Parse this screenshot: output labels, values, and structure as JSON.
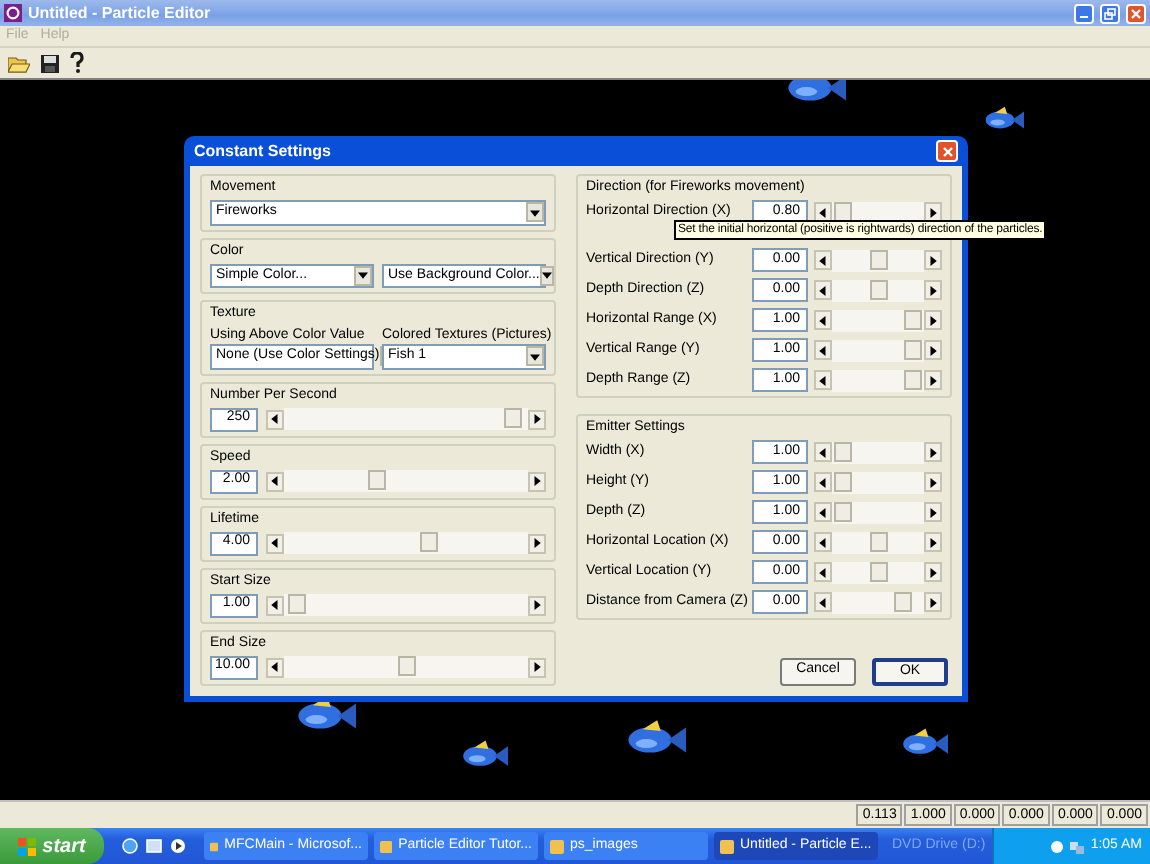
{
  "window": {
    "title": "Untitled - Particle Editor"
  },
  "menu": [
    {
      "label": "File",
      "disabled": true
    },
    {
      "label": "Help",
      "disabled": true
    }
  ],
  "dialog": {
    "title": "Constant Settings",
    "left_groups": [
      {
        "title": "Movement",
        "kind": "dropdowns",
        "dropdowns": [
          {
            "value": "Fireworks"
          }
        ]
      },
      {
        "title": "Color",
        "kind": "dropdowns",
        "dropdowns": [
          {
            "value": "Simple Color..."
          },
          {
            "value": "Use Background Color..."
          }
        ]
      },
      {
        "title": "Texture",
        "kind": "dropdowns",
        "dropdowns": [
          {
            "label": "Using Above Color Value",
            "value": "None (Use Color Settings)"
          },
          {
            "label": "Colored Textures (Pictures)",
            "value": "Fish 1"
          }
        ]
      },
      {
        "title": "Number Per Second",
        "kind": "slider",
        "value": "250",
        "level": 0.97
      },
      {
        "title": "Speed",
        "kind": "slider",
        "value": "2.00",
        "level": 0.37
      },
      {
        "title": "Lifetime",
        "kind": "slider",
        "value": "4.00",
        "level": 0.6
      },
      {
        "title": "Start Size",
        "kind": "slider",
        "value": "1.00",
        "level": 0.02
      },
      {
        "title": "End Size",
        "kind": "slider",
        "value": "10.00",
        "level": 0.5
      }
    ],
    "right_groups": [
      {
        "title": "Direction (for Fireworks movement)",
        "rows": [
          {
            "label": "Horizontal Direction (X)",
            "value": "0.80",
            "level": 0.03
          },
          {
            "label": "Vertical Direction (Y)",
            "value": "0.00",
            "level": 0.5
          },
          {
            "label": "Depth Direction (Z)",
            "value": "0.00",
            "level": 0.5
          },
          {
            "label": "Horizontal Range (X)",
            "value": "1.00",
            "level": 0.97
          },
          {
            "label": "Vertical Range (Y)",
            "value": "1.00",
            "level": 0.97
          },
          {
            "label": "Depth Range (Z)",
            "value": "1.00",
            "level": 0.97
          }
        ]
      },
      {
        "title": "Emitter Settings",
        "rows": [
          {
            "label": "Width (X)",
            "value": "1.00",
            "level": 0.03
          },
          {
            "label": "Height (Y)",
            "value": "1.00",
            "level": 0.03
          },
          {
            "label": "Depth (Z)",
            "value": "1.00",
            "level": 0.03
          },
          {
            "label": "Horizontal Location (X)",
            "value": "0.00",
            "level": 0.5
          },
          {
            "label": "Vertical Location (Y)",
            "value": "0.00",
            "level": 0.5
          },
          {
            "label": "Distance from Camera (Z)",
            "value": "0.00",
            "level": 0.83
          }
        ]
      }
    ],
    "buttons": [
      {
        "label": "Cancel",
        "default": false
      },
      {
        "label": "OK",
        "default": true
      }
    ]
  },
  "tooltip": {
    "text": "Set the initial horizontal (positive is rightwards) direction of the particles."
  },
  "status_bar": [
    "0.113",
    "1.000",
    "0.000",
    "0.000",
    "0.000",
    "0.000"
  ],
  "taskbar": {
    "start": "start",
    "tasks": [
      {
        "label": "MFCMain - Microsof...",
        "selected": false
      },
      {
        "label": "Particle Editor Tutor...",
        "selected": false
      },
      {
        "label": "ps_images",
        "selected": false
      },
      {
        "label": "Untitled - Particle E...",
        "selected": true
      }
    ],
    "tray_label": "DVD Drive (D:)",
    "time": "1:05 AM"
  }
}
